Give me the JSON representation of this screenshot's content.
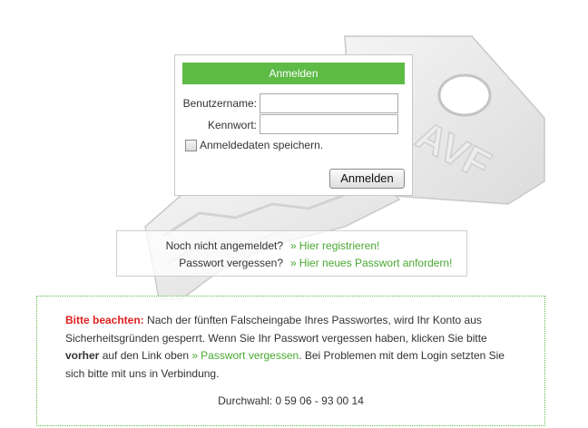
{
  "login": {
    "title": "Anmelden",
    "username_label": "Benutzername:",
    "username_value": "",
    "password_label": "Kennwort:",
    "password_value": "",
    "remember_label": "Anmeldedaten speichern.",
    "remember_checked": false,
    "submit_label": "Anmelden"
  },
  "links": {
    "register_question": "Noch nicht angemeldet?",
    "register_link": "Hier registrieren!",
    "forgot_question": "Passwort vergessen?",
    "forgot_link": "Hier neues Passwort anfordern!",
    "arrow": "»"
  },
  "notice": {
    "heading": "Bitte beachten:",
    "text_1": " Nach der fünften Falscheingabe Ihres Passwortes, wird Ihr Konto aus Sicherheitsgründen gesperrt. Wenn Sie Ihr Passwort vergessen haben, klicken Sie bitte ",
    "bold_word": "vorher",
    "text_2": " auf den Link oben ",
    "link_text": "Passwort vergessen",
    "text_3": ". Bei Problemen mit dem Login setzten Sie sich bitte mit uns in Verbindung.",
    "phone": "Durchwahl: 0 59 06 - 93 00 14"
  },
  "colors": {
    "accent": "#5dbb46",
    "link": "#49a832",
    "warning": "#e02020"
  }
}
